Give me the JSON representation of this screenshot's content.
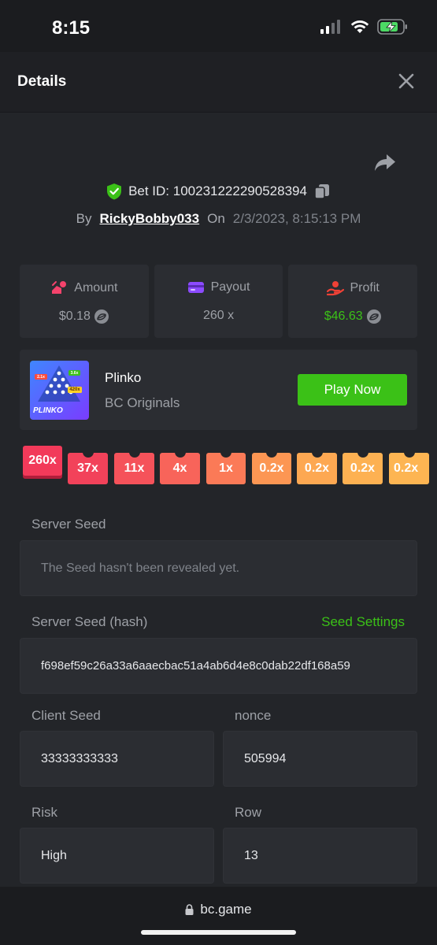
{
  "status_bar": {
    "time": "8:15"
  },
  "header": {
    "title": "Details"
  },
  "bet": {
    "id_label": "Bet ID: 100231222290528394",
    "by_label": "By",
    "user": "RickyBobby033",
    "on_label": "On",
    "date": "2/3/2023, 8:15:13 PM"
  },
  "stats": {
    "amount": {
      "label": "Amount",
      "value": "$0.18"
    },
    "payout": {
      "label": "Payout",
      "value": "260 x"
    },
    "profit": {
      "label": "Profit",
      "value": "$46.63"
    }
  },
  "game": {
    "name": "Plinko",
    "provider": "BC Originals",
    "play_label": "Play Now",
    "thumb_text": "PLINKO",
    "thumb_badges": [
      "2.1x",
      "3.6x",
      "420x"
    ]
  },
  "multipliers": [
    "260x",
    "37x",
    "11x",
    "4x",
    "1x",
    "0.2x",
    "0.2x",
    "0.2x",
    "0.2x"
  ],
  "seeds": {
    "server_seed_label": "Server Seed",
    "server_seed_value": "The Seed hasn't been revealed yet.",
    "server_hash_label": "Server Seed (hash)",
    "seed_settings_label": "Seed Settings",
    "server_hash_value": "f698ef59c26a33a6aaecbac51a4ab6d4e8c0dab22df168a59",
    "client_seed_label": "Client Seed",
    "client_seed_value": "33333333333",
    "nonce_label": "nonce",
    "nonce_value": "505994",
    "risk_label": "Risk",
    "risk_value": "High",
    "row_label": "Row",
    "row_value": "13"
  },
  "browser": {
    "url": "bc.game"
  },
  "colors": {
    "accent_green": "#3bc117",
    "panel": "#2b2d32",
    "background": "#232529"
  }
}
